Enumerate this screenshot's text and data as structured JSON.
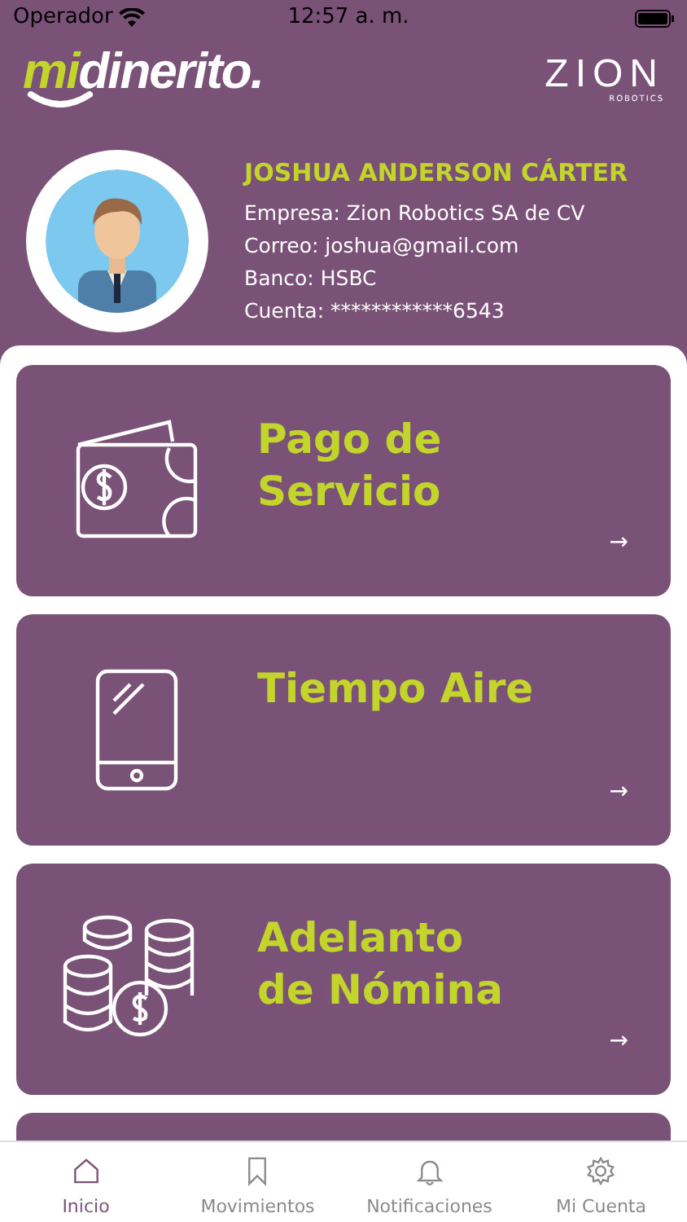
{
  "status_bar": {
    "carrier": "Operador",
    "time": "12:57 a. m."
  },
  "header": {
    "logo_highlight": "mi",
    "logo_rest": "dinerito.",
    "partner_logo": "ZION",
    "partner_tagline": "ROBOTICS"
  },
  "profile": {
    "name": "JOSHUA ANDERSON CÁRTER",
    "details": [
      "Empresa:  Zion Robotics SA de CV",
      "Correo:  joshua@gmail.com",
      "Banco:  HSBC",
      "Cuenta:  ************6543"
    ]
  },
  "cards": [
    {
      "kind": "wallet",
      "title": "Pago de\nServicio",
      "arrow": "→"
    },
    {
      "kind": "phone",
      "title": "Tiempo Aire",
      "arrow": "→"
    },
    {
      "kind": "coins",
      "title": "Adelanto\nde Nómina",
      "arrow": "→"
    }
  ],
  "tabs": [
    {
      "kind": "home",
      "label": "Inicio",
      "selected": true
    },
    {
      "kind": "bookmark",
      "label": "Movimientos",
      "selected": false
    },
    {
      "kind": "bell",
      "label": "Notificaciones",
      "selected": false
    },
    {
      "kind": "gear",
      "label": "Mi Cuenta",
      "selected": false
    }
  ]
}
